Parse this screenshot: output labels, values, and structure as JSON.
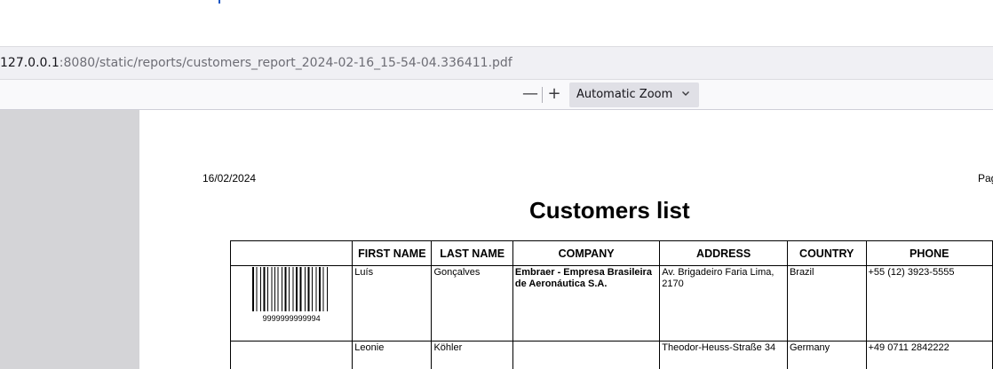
{
  "browser": {
    "url_host": "127.0.0.1",
    "url_rest": ":8080/static/reports/customers_report_2024-02-16_15-54-04.336411.pdf"
  },
  "toolbar": {
    "zoom_out_label": "—",
    "zoom_in_label": "+",
    "zoom_select_label": "Automatic Zoom"
  },
  "report": {
    "date": "16/02/2024",
    "page_label": "Pag",
    "title": "Customers list",
    "headers": [
      "",
      "FIRST NAME",
      "LAST NAME",
      "COMPANY",
      "ADDRESS",
      "COUNTRY",
      "PHONE"
    ],
    "rows": [
      {
        "barcode": "9999999999994",
        "first_name": "Luís",
        "last_name": "Gonçalves",
        "company": "Embraer - Empresa Brasileira de Aeronáutica S.A.",
        "address": "Av. Brigadeiro Faria Lima, 2170",
        "country": "Brazil",
        "phone": "+55 (12) 3923-5555"
      },
      {
        "barcode": "",
        "first_name": "Leonie",
        "last_name": "Köhler",
        "company": "",
        "address": "Theodor-Heuss-Straße 34",
        "country": "Germany",
        "phone": "+49 0711 2842222"
      }
    ]
  },
  "colors": {
    "viewer_background": "#d4d4d7",
    "toolbar_background": "#f9f9fb",
    "url_bar_background": "#f0f0f4"
  }
}
